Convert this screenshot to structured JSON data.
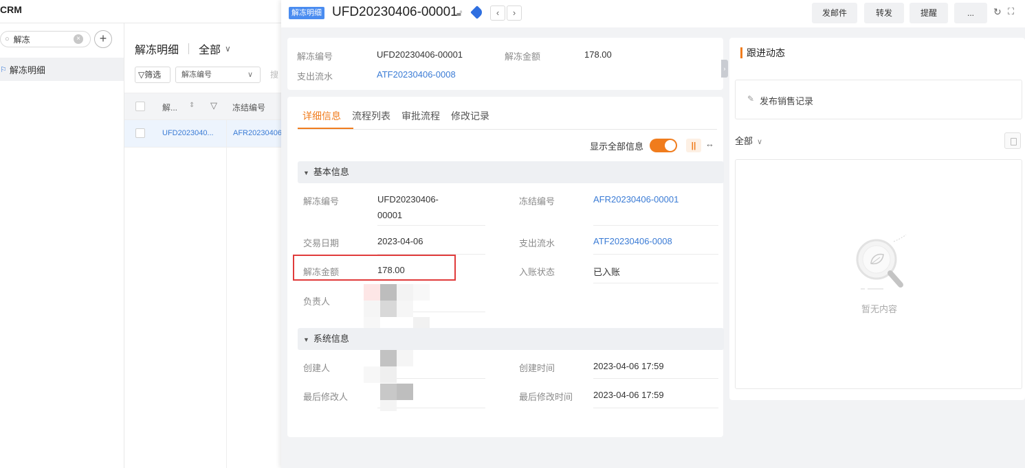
{
  "app": {
    "brand": "CRM"
  },
  "nav": {
    "search_value": "解冻",
    "items": [
      {
        "label": "解冻明细"
      }
    ]
  },
  "list": {
    "title": "解冻明细",
    "scope": "全部",
    "filter_label": "筛选",
    "filter_field": "解冻编号",
    "filter_more": "搜",
    "columns": [
      "解...",
      "冻结编号"
    ],
    "rows": [
      {
        "col1": "UFD2023040...",
        "col2": "AFR20230406"
      }
    ]
  },
  "drawer": {
    "module_badge": "解冻明细",
    "record_id": "UFD20230406-00001",
    "actions": {
      "email": "发邮件",
      "forward": "转发",
      "remind": "提醒",
      "more": "..."
    }
  },
  "summary": {
    "fields": [
      {
        "label": "解冻编号",
        "value": "UFD20230406-00001"
      },
      {
        "label": "解冻金额",
        "value": "178.00"
      },
      {
        "label": "支出流水",
        "value": "ATF20230406-0008"
      }
    ]
  },
  "detail": {
    "tabs": [
      "详细信息",
      "流程列表",
      "审批流程",
      "修改记录"
    ],
    "active_tab": "详细信息",
    "show_all_label": "显示全部信息",
    "show_all_on": true,
    "sections": {
      "basic": {
        "title": "基本信息",
        "unfreeze_no_label": "解冻编号",
        "unfreeze_no_line1": "UFD20230406-",
        "unfreeze_no_line2": "00001",
        "freeze_no_label": "冻结编号",
        "freeze_no_value": "AFR20230406-00001",
        "trade_date_label": "交易日期",
        "trade_date_value": "2023-04-06",
        "payout_flow_label": "支出流水",
        "payout_flow_value": "ATF20230406-0008",
        "amount_label": "解冻金额",
        "amount_value": "178.00",
        "status_label": "入账状态",
        "status_value": "已入账",
        "owner_label": "负责人"
      },
      "system": {
        "title": "系统信息",
        "creator_label": "创建人",
        "created_time_label": "创建时间",
        "created_time_value": "2023-04-06 17:59",
        "modifier_label": "最后修改人",
        "modified_time_label": "最后修改时间",
        "modified_time_value": "2023-04-06 17:59"
      }
    }
  },
  "activity": {
    "title": "跟进动态",
    "post_label": "发布销售记录",
    "filter": "全部",
    "empty_text": "暂无内容"
  },
  "colors": {
    "accent": "#f07c1d",
    "link": "#3a7bd5",
    "highlight": "#e03a3a",
    "badge": "#4a8cf0"
  }
}
